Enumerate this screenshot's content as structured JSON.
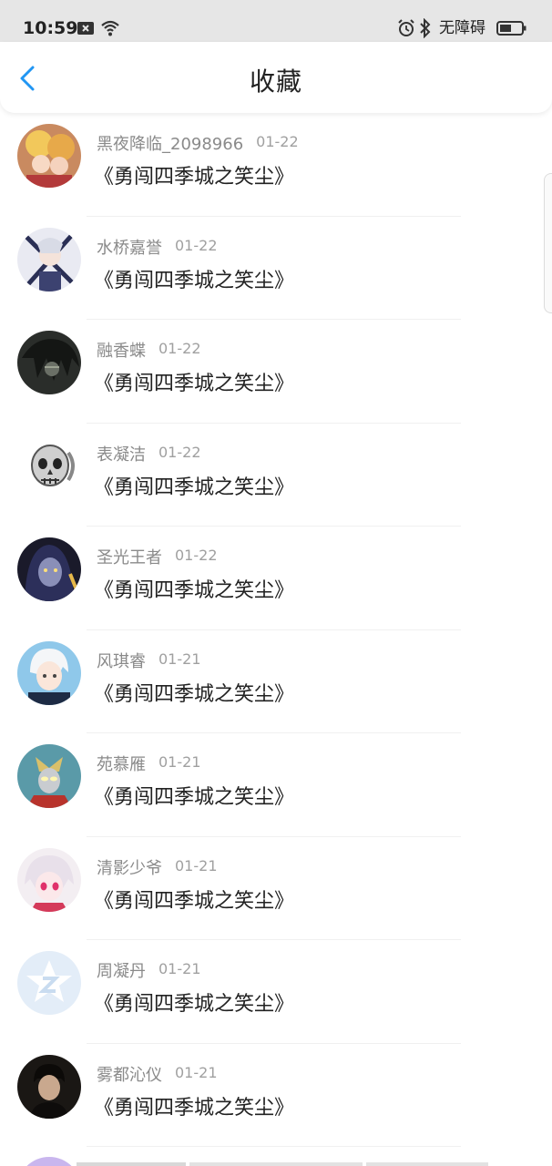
{
  "status_bar": {
    "time": "10:59",
    "accessibility_text": "无障碍",
    "icons": [
      "notification-x-icon",
      "wifi-icon",
      "alarm-icon",
      "bluetooth-icon",
      "battery-icon"
    ]
  },
  "header": {
    "title": "收藏",
    "back_icon": "chevron-left-icon"
  },
  "colors": {
    "accent": "#2196f3",
    "title_text": "#222222",
    "username_text": "#8a8a8a",
    "date_text": "#a0a0a0"
  },
  "favorites": [
    {
      "user": "黑夜降临_2098966",
      "date": "01-22",
      "title": "《勇闯四季城之笑尘》",
      "avatar": "anime-girls-avatar"
    },
    {
      "user": "水桥嘉誉",
      "date": "01-22",
      "title": "《勇闯四季城之笑尘》",
      "avatar": "anime-swordsman-avatar"
    },
    {
      "user": "融香蝶",
      "date": "01-22",
      "title": "《勇闯四季城之笑尘》",
      "avatar": "dark-hair-avatar"
    },
    {
      "user": "表凝洁",
      "date": "01-22",
      "title": "《勇闯四季城之笑尘》",
      "avatar": "skull-ring-avatar"
    },
    {
      "user": "圣光王者",
      "date": "01-22",
      "title": "《勇闯四季城之笑尘》",
      "avatar": "hooded-figure-avatar"
    },
    {
      "user": "风琪睿",
      "date": "01-21",
      "title": "《勇闯四季城之笑尘》",
      "avatar": "white-hair-boy-avatar"
    },
    {
      "user": "苑慕雁",
      "date": "01-21",
      "title": "《勇闯四季城之笑尘》",
      "avatar": "ultraman-avatar"
    },
    {
      "user": "清影少爷",
      "date": "01-21",
      "title": "《勇闯四季城之笑尘》",
      "avatar": "anime-pink-eyes-avatar"
    },
    {
      "user": "周凝丹",
      "date": "01-21",
      "title": "《勇闯四季城之笑尘》",
      "avatar": "default-star-avatar"
    },
    {
      "user": "雾都沁仪",
      "date": "01-21",
      "title": "《勇闯四季城之笑尘》",
      "avatar": "dark-portrait-avatar"
    }
  ]
}
